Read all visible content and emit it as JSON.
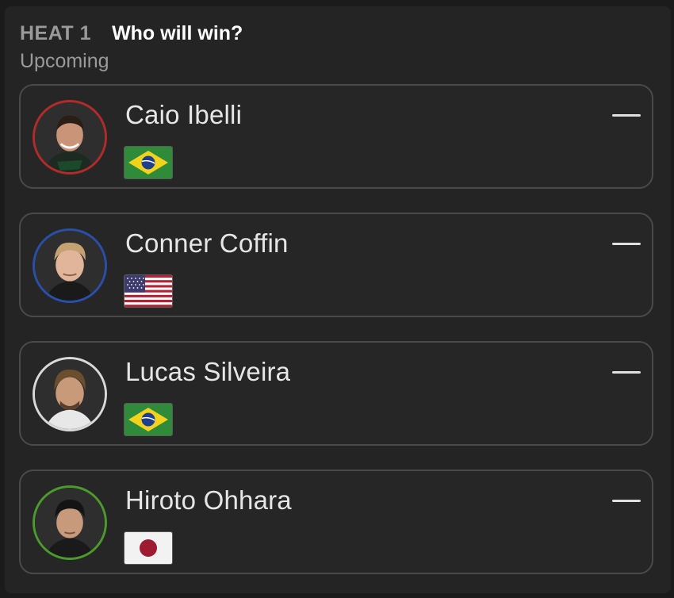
{
  "heat": {
    "label": "HEAT 1",
    "question": "Who will win?",
    "status": "Upcoming"
  },
  "surfers": [
    {
      "name": "Caio Ibelli",
      "ring_color": "#b22b2b",
      "flag": "brazil-flag",
      "pick_indicator": "—"
    },
    {
      "name": "Conner Coffin",
      "ring_color": "#2a4fa8",
      "flag": "usa-flag",
      "pick_indicator": "—"
    },
    {
      "name": "Lucas Silveira",
      "ring_color": "#d9d9d9",
      "flag": "brazil-flag",
      "pick_indicator": "—"
    },
    {
      "name": "Hiroto Ohhara",
      "ring_color": "#4a9a2c",
      "flag": "japan-flag",
      "pick_indicator": "—"
    }
  ]
}
